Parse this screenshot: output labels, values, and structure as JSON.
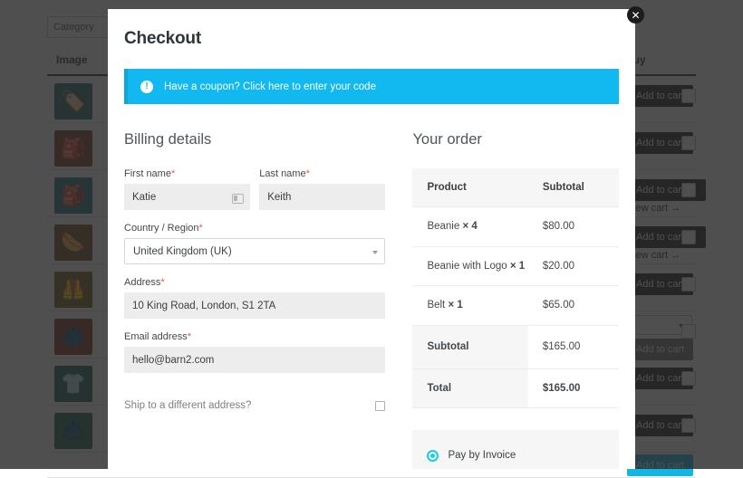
{
  "background": {
    "category_filter": "Category",
    "columns": {
      "image": "Image",
      "buy": "Buy"
    },
    "rows": [
      {
        "thumb": "🏷️",
        "thumb_bg": "#2a6b66",
        "button": "Add to cart",
        "state": "default"
      },
      {
        "thumb": "🎒",
        "thumb_bg": "#7a3b2a",
        "button": "Add to cart",
        "state": "default"
      },
      {
        "thumb": "🎒",
        "thumb_bg": "#1d6d78",
        "button": "Add to cart",
        "state": "added",
        "view_cart": "View cart →"
      },
      {
        "thumb": "🌭",
        "thumb_bg": "#6b4a20",
        "button": "Add to cart",
        "state": "added",
        "view_cart": "View cart →"
      },
      {
        "thumb": "🦺",
        "thumb_bg": "#6f5a16",
        "button": "Add to cart",
        "state": "default"
      },
      {
        "thumb": "🧥",
        "thumb_bg": "#7a3520",
        "button": "Add to cart",
        "state": "variation"
      },
      {
        "thumb": "👕",
        "thumb_bg": "#1f5e55",
        "button": "Add to cart",
        "state": "default"
      },
      {
        "thumb": "🧥",
        "thumb_bg": "#1f5e4a",
        "button": "Add to cart",
        "state": "default"
      },
      {
        "thumb": "",
        "thumb_bg": "#2a2a2a",
        "button": "Add to cart",
        "state": "cyan"
      }
    ]
  },
  "modal": {
    "close_label": "✕",
    "title": "Checkout",
    "coupon": {
      "icon": "!",
      "text": "Have a coupon? Click here to enter your code",
      "bg_color": "#12b8f0"
    },
    "billing": {
      "heading": "Billing details",
      "first_name": {
        "label": "First name",
        "value": "Katie",
        "required": "*"
      },
      "last_name": {
        "label": "Last name",
        "value": "Keith",
        "required": "*"
      },
      "country": {
        "label": "Country / Region",
        "value": "United Kingdom (UK)",
        "required": "*"
      },
      "address": {
        "label": "Address",
        "value": "10 King Road, London, S1 2TA",
        "required": "*"
      },
      "email": {
        "label": "Email address",
        "value": "hello@barn2.com",
        "required": "*"
      },
      "ship_different": "Ship to a different address?"
    },
    "order": {
      "heading": "Your order",
      "headers": {
        "product": "Product",
        "subtotal": "Subtotal"
      },
      "items": [
        {
          "name": "Beanie",
          "qty": "× 4",
          "subtotal": "$80.00"
        },
        {
          "name": "Beanie with Logo",
          "qty": "× 1",
          "subtotal": "$20.00"
        },
        {
          "name": "Belt",
          "qty": "× 1",
          "subtotal": "$65.00"
        }
      ],
      "subtotal_label": "Subtotal",
      "subtotal_value": "$165.00",
      "total_label": "Total",
      "total_value": "$165.00"
    },
    "payment": {
      "method_label": "Pay by Invoice",
      "accent_color": "#18cfe8"
    }
  }
}
